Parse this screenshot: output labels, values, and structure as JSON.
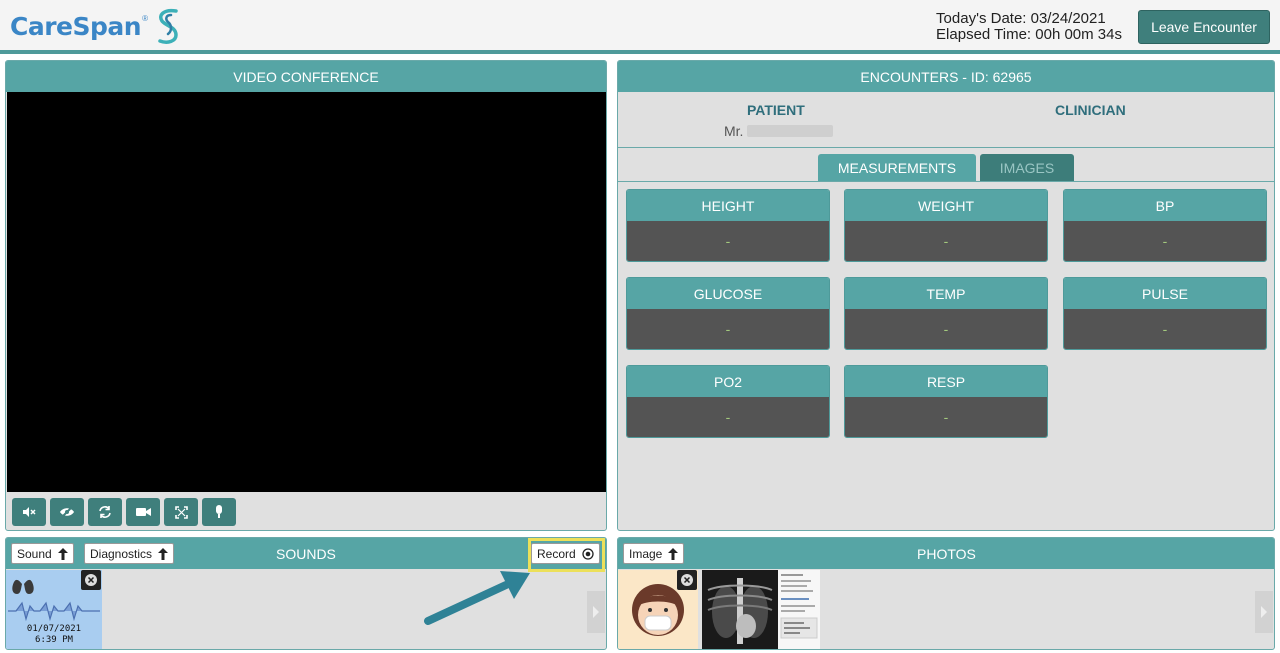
{
  "header": {
    "logo_text": "CareSpan",
    "logo_tm": "®",
    "date_label": "Today's Date: 03/24/2021",
    "elapsed_label": "Elapsed Time: 00h 00m 34s",
    "leave_button": "Leave Encounter"
  },
  "video": {
    "title": "VIDEO CONFERENCE",
    "controls": [
      "mute-icon",
      "hide-video-icon",
      "switch-camera-icon",
      "camera-icon",
      "fullscreen-icon",
      "mic-icon"
    ]
  },
  "encounter": {
    "title": "ENCOUNTERS - ID: 62965",
    "patient_label": "PATIENT",
    "clinician_label": "CLINICIAN",
    "patient_prefix": "Mr.",
    "tabs": [
      {
        "label": "MEASUREMENTS",
        "active": true
      },
      {
        "label": "IMAGES",
        "active": false
      }
    ],
    "measurements": [
      {
        "name": "HEIGHT",
        "value": "-"
      },
      {
        "name": "WEIGHT",
        "value": "-"
      },
      {
        "name": "BP",
        "value": "-"
      },
      {
        "name": "GLUCOSE",
        "value": "-"
      },
      {
        "name": "TEMP",
        "value": "-"
      },
      {
        "name": "PULSE",
        "value": "-"
      },
      {
        "name": "PO2",
        "value": "-"
      },
      {
        "name": "RESP",
        "value": "-"
      }
    ]
  },
  "sounds": {
    "title": "SOUNDS",
    "sound_button": "Sound",
    "diagnostics_button": "Diagnostics",
    "record_button": "Record",
    "thumb_date": "01/07/2021",
    "thumb_time": "6:39 PM"
  },
  "photos": {
    "title": "PHOTOS",
    "image_button": "Image"
  },
  "colors": {
    "teal": "#56a5a5",
    "dark_teal": "#3f7f7c",
    "brand_blue": "#3b86c6",
    "highlight": "#ece05a"
  }
}
